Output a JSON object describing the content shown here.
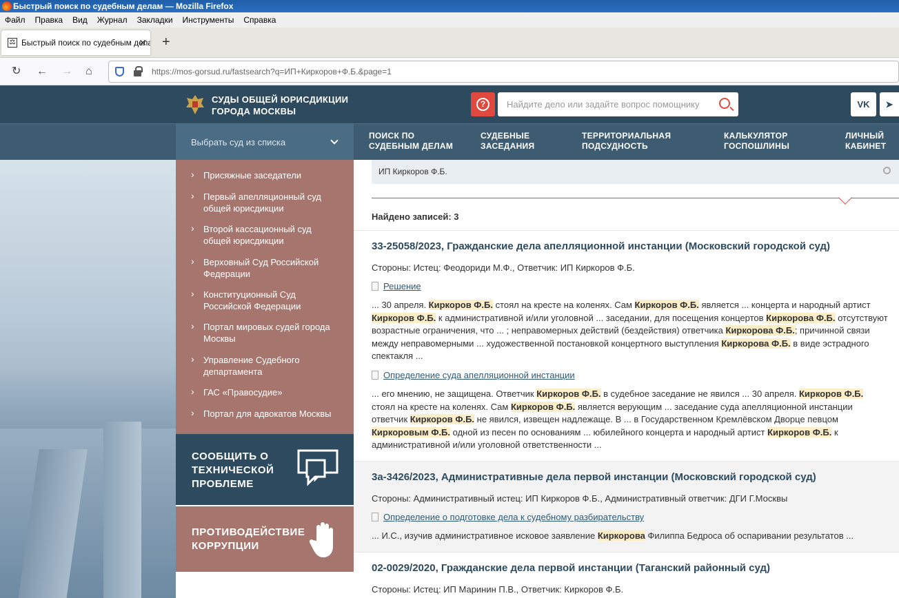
{
  "browser": {
    "window_title": "Быстрый поиск по судебным делам — Mozilla Firefox",
    "menu": [
      "Файл",
      "Правка",
      "Вид",
      "Журнал",
      "Закладки",
      "Инструменты",
      "Справка"
    ],
    "tab_title": "Быстрый поиск по судебным делам",
    "url_domain": "https://mos-gorsud.ru",
    "url_path": "/fastsearch?q=ИП+Киркоров+Ф.Б.&page=1"
  },
  "header": {
    "logo_line1": "СУДЫ ОБЩЕЙ ЮРИСДИКЦИИ",
    "logo_line2": "ГОРОДА МОСКВЫ",
    "search_placeholder": "Найдите дело или задайте вопрос помощнику",
    "social": [
      "vk",
      "telegram"
    ]
  },
  "nav": {
    "court_select": "Выбрать суд из списка",
    "items": [
      {
        "l1": "ПОИСК ПО",
        "l2": "СУДЕБНЫМ ДЕЛАМ"
      },
      {
        "l1": "СУДЕБНЫЕ",
        "l2": "ЗАСЕДАНИЯ"
      },
      {
        "l1": "ТЕРРИТОРИАЛЬНАЯ",
        "l2": "ПОДСУДНОСТЬ"
      },
      {
        "l1": "КАЛЬКУЛЯТОР",
        "l2": "ГОСПОШЛИНЫ"
      },
      {
        "l1": "ЛИЧНЫЙ",
        "l2": "КАБИНЕТ"
      }
    ]
  },
  "sidebar": {
    "items": [
      {
        "l1": "Присяжные заседатели",
        "l2": ""
      },
      {
        "l1": "Первый апелляционный суд",
        "l2": "общей юрисдикции"
      },
      {
        "l1": "Второй кассационный суд",
        "l2": "общей юрисдикции"
      },
      {
        "l1": "Верховный Суд Российской",
        "l2": "Федерации"
      },
      {
        "l1": "Конституционный Суд",
        "l2": "Российской Федерации"
      },
      {
        "l1": "Портал мировых судей города",
        "l2": "Москвы"
      },
      {
        "l1": "Управление Судебного",
        "l2": "департамента"
      },
      {
        "l1": "ГАС «Правосудие»",
        "l2": ""
      },
      {
        "l1": "Портал для адвокатов Москвы",
        "l2": ""
      }
    ],
    "report": {
      "l1": "СООБЩИТЬ О",
      "l2": "ТЕХНИЧЕСКОЙ",
      "l3": "ПРОБЛЕМЕ"
    },
    "anticorruption": {
      "l1": "ПРОТИВОДЕЙСТВИЕ",
      "l2": "КОРРУПЦИИ"
    }
  },
  "search": {
    "query": "ИП Киркоров Ф.Б.",
    "found": "Найдено записей: 3"
  },
  "results": [
    {
      "title": "33-25058/2023, Гражданские дела апелляционной инстанции (Московский городской суд)",
      "parties": "Стороны: Истец: Феодориди М.Ф., Ответчик: ИП Киркоров Ф.Б.",
      "doc1": "Решение",
      "doc2": "Определение суда апелляционной инстанции"
    },
    {
      "title": "3а-3426/2023, Административные дела первой инстанции (Московский городской суд)",
      "parties": "Стороны: Административный истец: ИП Киркоров Ф.Б., Административный ответчик: ДГИ Г.Москвы",
      "doc1": "Определение о подготовке дела к судебному разбирательству"
    },
    {
      "title": "02-0029/2020, Гражданские дела первой инстанции (Таганский районный суд)",
      "parties": "Стороны: Истец: ИП Маринин П.В., Ответчик: Киркоров Ф.Б."
    }
  ],
  "snippets": {
    "s1": [
      "... 30 апреля. ",
      "Киркоров Ф.Б.",
      " стоял на кресте на коленях. Сам ",
      "Киркоров Ф.Б.",
      " является ... концерта и народный артист ",
      "Киркоров Ф.Б.",
      " к административной и/или уголовной ... заседании, для посещения концертов ",
      "Киркорова Ф.Б.",
      " отсутствуют возрастные ограничения, что ... ; неправомерных действий (бездействия) ответчика ",
      "Киркорова Ф.Б.",
      "; причинной связи между неправомерными ... художественной постановкой концертного выступления ",
      "Киркорова Ф.Б.",
      " в виде эстрадного спектакля ..."
    ],
    "s2": [
      "... его мнению, не защищена. Ответчик ",
      "Киркоров Ф.Б.",
      " в судебное заседание не явился ... 30 апреля. ",
      "Киркоров Ф.Б.",
      " стоял на кресте на коленях. Сам ",
      "Киркоров Ф.Б.",
      " является верующим ... заседание суда апелляционной инстанции ответчик ",
      "Киркоров Ф.Б.",
      " не явился, извещен надлежаще. В ... в Государственном Кремлёвском Дворце певцом ",
      "Киркоровым Ф.Б.",
      " одной из песен по основаниям ... юбилейного концерта и народный артист ",
      "Киркоров Ф.Б.",
      " к административной и/или уголовной ответственности ..."
    ],
    "s3": [
      "... И.С., изучив административное исковое заявление ",
      "Киркорова",
      " Филиппа Бедроса об оспаривании результатов ..."
    ]
  }
}
